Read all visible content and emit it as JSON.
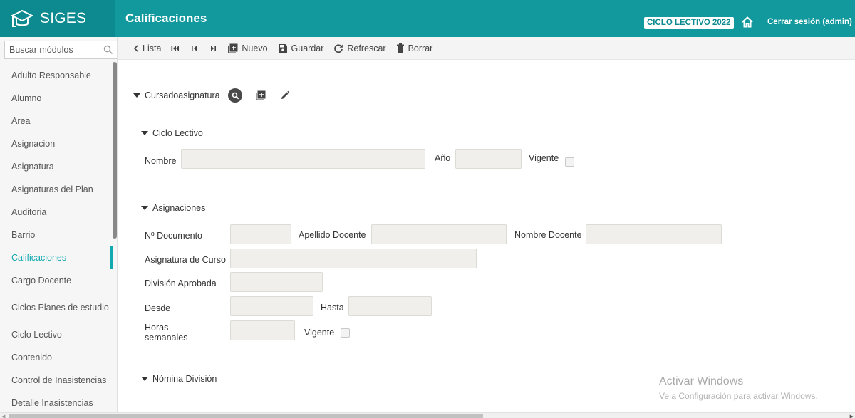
{
  "app": {
    "logo_text": "SIGES",
    "page_title": "Calificaciones",
    "cycle_badge": "CICLO LECTIVO 2022",
    "logout_label": "Cerrar sesión (admin)",
    "colors": {
      "header": "#11999e",
      "logo_bg": "#0c8a8f",
      "active": "#11a9b0"
    }
  },
  "sidebar": {
    "search_placeholder": "Buscar módulos",
    "items": [
      {
        "label": "Adulto Responsable"
      },
      {
        "label": "Alumno"
      },
      {
        "label": "Area"
      },
      {
        "label": "Asignacion"
      },
      {
        "label": "Asignatura"
      },
      {
        "label": "Asignaturas del Plan"
      },
      {
        "label": "Auditoria"
      },
      {
        "label": "Barrio"
      },
      {
        "label": "Calificaciones",
        "active": true
      },
      {
        "label": "Cargo Docente"
      },
      {
        "label": "Ciclos Planes de estudio"
      },
      {
        "label": "Ciclo Lectivo"
      },
      {
        "label": "Contenido"
      },
      {
        "label": "Control de Inasistencias"
      },
      {
        "label": "Detalle Inasistencias"
      }
    ]
  },
  "toolbar": {
    "list_label": "Lista",
    "new_label": "Nuevo",
    "save_label": "Guardar",
    "refresh_label": "Refrescar",
    "delete_label": "Borrar"
  },
  "form": {
    "main_section": "Cursadoasignatura",
    "ciclo": {
      "title": "Ciclo Lectivo",
      "nombre_label": "Nombre",
      "anio_label": "Año",
      "vigente_label": "Vigente"
    },
    "asignaciones": {
      "title": "Asignaciones",
      "documento_label": "Nº Documento",
      "apellido_label": "Apellido Docente",
      "nombre_docente_label": "Nombre Docente",
      "asignatura_curso_label": "Asignatura de Curso",
      "division_label": "División Aprobada",
      "desde_label": "Desde",
      "hasta_label": "Hasta",
      "horas_label": "Horas semanales",
      "vigente_label": "Vigente"
    },
    "nomina": {
      "title": "Nómina División"
    }
  },
  "watermark": {
    "line1": "Activar Windows",
    "line2": "Ve a Configuración para activar Windows."
  }
}
